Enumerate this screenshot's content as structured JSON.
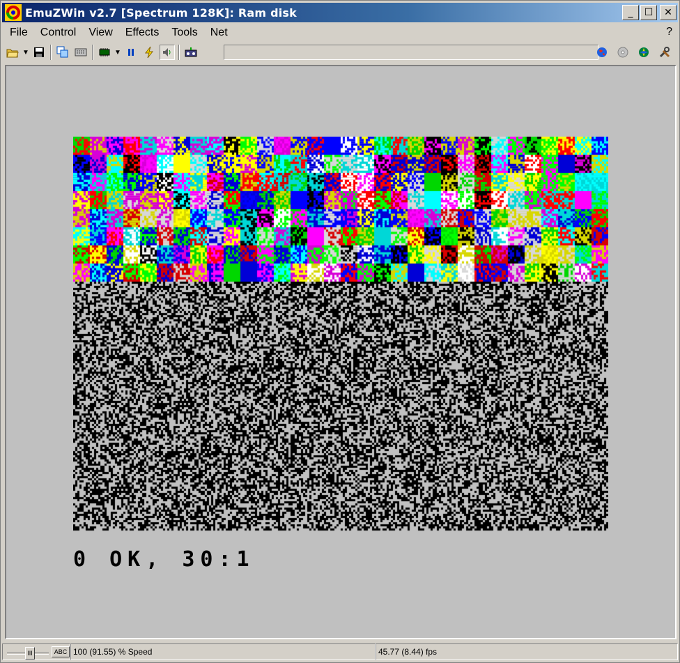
{
  "window": {
    "title": "EmuZWin v2.7 [Spectrum 128K]: Ram disk",
    "minimize": "_",
    "maximize": "☐",
    "close": "✕"
  },
  "menu": {
    "items": [
      "File",
      "Control",
      "View",
      "Effects",
      "Tools",
      "Net"
    ],
    "help": "?"
  },
  "toolbar": {
    "icons": [
      "open-icon",
      "dropdown-icon",
      "save-icon",
      "copy-icon",
      "keyboard-icon",
      "memory-icon",
      "dropdown-icon",
      "pause-icon",
      "turbo-icon",
      "sound-icon",
      "tape-icon"
    ],
    "right_icons": [
      "globe-icon",
      "disk-icon",
      "compass-icon",
      "tools-icon"
    ]
  },
  "screen": {
    "prompt": "0 OK, 30:1",
    "ink": "#000000",
    "paper": "#c0c0c0"
  },
  "status": {
    "slider_thumb": "III",
    "abc_label": "ABC",
    "speed": "100 (91.55) % Speed",
    "fps": "45.77 (8.44) fps"
  },
  "colors": {
    "zx_palette": [
      "#000000",
      "#0000d7",
      "#d70000",
      "#d700d7",
      "#00d700",
      "#00d7d7",
      "#d7d700",
      "#d7d7d7",
      "#0000ff",
      "#ff0000",
      "#ff00ff",
      "#00ff00",
      "#00ffff",
      "#ffff00",
      "#ffffff"
    ]
  }
}
